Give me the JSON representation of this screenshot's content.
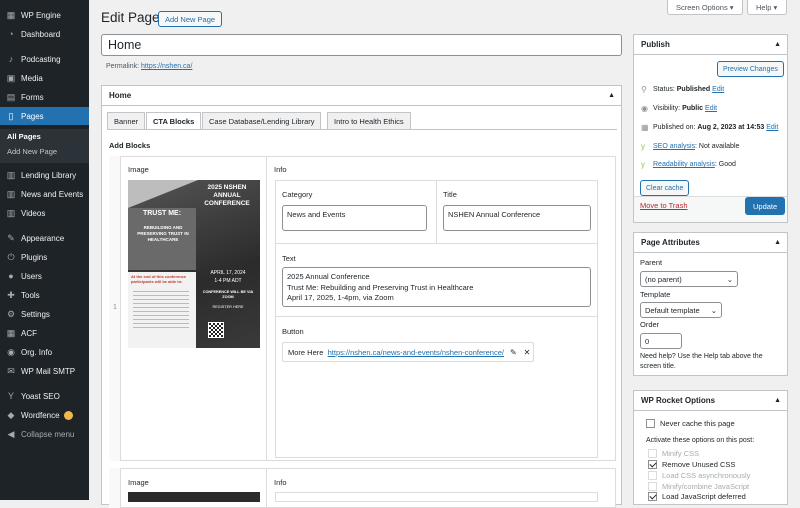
{
  "sidebar": {
    "items": [
      {
        "label": "WP Engine",
        "icon": "wpengine-icon"
      },
      {
        "label": "Dashboard",
        "icon": "dashboard-icon"
      },
      {
        "label": "Podcasting",
        "icon": "microphone-icon"
      },
      {
        "label": "Media",
        "icon": "media-icon"
      },
      {
        "label": "Forms",
        "icon": "forms-icon"
      },
      {
        "label": "Pages",
        "icon": "pages-icon"
      },
      {
        "label": "Lending Library",
        "icon": "book-icon"
      },
      {
        "label": "News and Events",
        "icon": "news-icon"
      },
      {
        "label": "Videos",
        "icon": "video-icon"
      },
      {
        "label": "Appearance",
        "icon": "brush-icon"
      },
      {
        "label": "Plugins",
        "icon": "plugin-icon"
      },
      {
        "label": "Users",
        "icon": "users-icon"
      },
      {
        "label": "Tools",
        "icon": "tools-icon"
      },
      {
        "label": "Settings",
        "icon": "settings-icon"
      },
      {
        "label": "ACF",
        "icon": "acf-icon"
      },
      {
        "label": "Org. Info",
        "icon": "info-icon"
      },
      {
        "label": "WP Mail SMTP",
        "icon": "mail-icon"
      },
      {
        "label": "Yoast SEO",
        "icon": "yoast-icon"
      },
      {
        "label": "Wordfence",
        "icon": "wordfence-icon"
      },
      {
        "label": "Collapse menu",
        "icon": "collapse-icon"
      }
    ],
    "pages_sub": [
      "All Pages",
      "Add New Page"
    ],
    "accent": "#2271b1"
  },
  "top": {
    "screen_options": "Screen Options",
    "help": "Help"
  },
  "header": {
    "title": "Edit Page",
    "add_new": "Add New Page"
  },
  "post_title": "Home",
  "permalink": {
    "label": "Permalink:",
    "url": "https://nshen.ca/"
  },
  "home_box": {
    "title": "Home",
    "tabs": [
      "Banner",
      "CTA Blocks",
      "Case Database/Lending Library",
      "Intro to Health Ethics"
    ],
    "add_blocks": "Add Blocks",
    "col_image": "Image",
    "col_info": "Info",
    "row_num": "1",
    "category_label": "Category",
    "category_value": "News and Events",
    "title_label": "Title",
    "title_value": "NSHEN Annual Conference",
    "text_label": "Text",
    "text_lines": [
      "2025 Annual Conference",
      "Trust Me: Rebuilding and Preserving Trust in Healthcare",
      "April 17, 2025, 1-4pm, via Zoom"
    ],
    "button_label": "Button",
    "button_text": "More Here",
    "button_url": "https://nshen.ca/news-and-events/nshen-conference/",
    "col_image2": "Image",
    "col_info2": "Info"
  },
  "poster": {
    "trust_me": "TRUST ME:",
    "subtitle": "REBUILDING AND PRESERVING TRUST IN HEALTHCARE",
    "conf_title": "2025 NSHEN ANNUAL CONFERENCE",
    "date": "APRIL 17, 2024",
    "time": "1-4 PM ADT",
    "via": "CONFERENCE WILL BE VIA ZOOM",
    "register": "REGISTER HERE",
    "end_text": "At the end of this conference participants will be able to:"
  },
  "publish": {
    "title": "Publish",
    "preview": "Preview Changes",
    "status_label": "Status:",
    "status_value": "Published",
    "edit": "Edit",
    "visibility_label": "Visibility:",
    "visibility_value": "Public",
    "published_label": "Published on:",
    "published_value": "Aug 2, 2023 at 14:53",
    "seo_label": "SEO analysis",
    "seo_value": ": Not available",
    "read_label": "Readability analysis",
    "read_value": ": Good",
    "clear_cache": "Clear cache",
    "trash": "Move to Trash",
    "update": "Update"
  },
  "attributes": {
    "title": "Page Attributes",
    "parent_label": "Parent",
    "parent_value": "(no parent)",
    "template_label": "Template",
    "template_value": "Default template",
    "order_label": "Order",
    "order_value": "0",
    "help": "Need help? Use the Help tab above the screen title."
  },
  "rocket": {
    "title": "WP Rocket Options",
    "never_cache": "Never cache this page",
    "activate": "Activate these options on this post:",
    "options": [
      {
        "label": "Minify CSS",
        "checked": false,
        "disabled": true
      },
      {
        "label": "Remove Unused CSS",
        "checked": true,
        "disabled": false
      },
      {
        "label": "Load CSS asynchronously",
        "checked": false,
        "disabled": true
      },
      {
        "label": "Minify/combine JavaScript",
        "checked": false,
        "disabled": true
      },
      {
        "label": "Load JavaScript deferred",
        "checked": true,
        "disabled": false
      }
    ]
  }
}
